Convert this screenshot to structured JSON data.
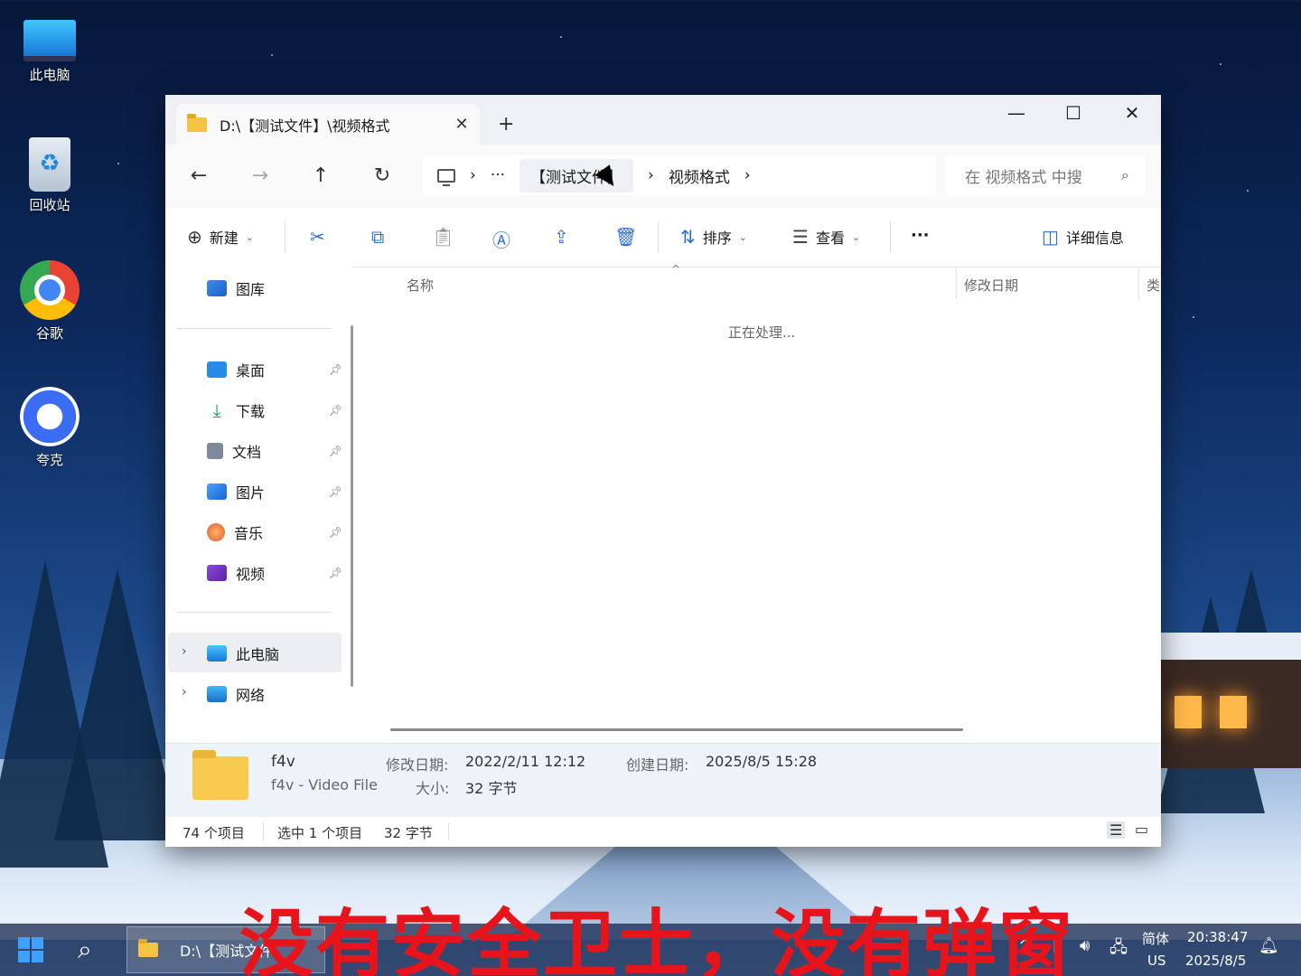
{
  "desktop": {
    "icons": [
      {
        "label": "此电脑"
      },
      {
        "label": "回收站"
      },
      {
        "label": "谷歌"
      },
      {
        "label": "夸克"
      }
    ]
  },
  "explorer": {
    "tab_title": "D:\\【测试文件】\\视频格式",
    "tab_close": "✕",
    "new_tab": "+",
    "window_controls": {
      "minimize": "—",
      "maximize": "☐",
      "close": "✕"
    },
    "nav": {
      "back": "←",
      "forward": "→",
      "up": "↑",
      "refresh": "↻"
    },
    "breadcrumbs": {
      "more": "···",
      "sep": "›",
      "items": [
        "【测试文件】",
        "视频格式"
      ]
    },
    "search": {
      "placeholder": "在 视频格式 中搜",
      "icon": "⌕"
    },
    "toolbar": {
      "new_label": "新建",
      "sort_label": "排序",
      "view_label": "查看",
      "more_label": "···",
      "details_label": "详细信息"
    },
    "sidebar": {
      "top": [
        {
          "label": "图库"
        }
      ],
      "pinned": [
        {
          "label": "桌面"
        },
        {
          "label": "下载"
        },
        {
          "label": "文档"
        },
        {
          "label": "图片"
        },
        {
          "label": "音乐"
        },
        {
          "label": "视频"
        }
      ],
      "locations": [
        {
          "label": "此电脑"
        },
        {
          "label": "网络"
        }
      ]
    },
    "columns": {
      "name": "名称",
      "modified": "修改日期",
      "type": "类"
    },
    "processing_text": "正在处理...",
    "details_pane": {
      "file_name": "f4v",
      "file_type": "f4v - Video File",
      "modified_label": "修改日期:",
      "modified_value": "2022/2/11 12:12",
      "size_label": "大小:",
      "size_value": "32 字节",
      "created_label": "创建日期:",
      "created_value": "2025/8/5 15:28"
    },
    "status_bar": {
      "item_count": "74 个项目",
      "selection": "选中 1 个项目",
      "selection_size": "32 字节"
    }
  },
  "taskbar": {
    "app_label": "D:\\【测试文件",
    "ime_lang": "简体",
    "ime_layout": "US",
    "time": "20:38:47",
    "date": "2025/8/5"
  },
  "caption": "没有安全卫士，没有弹窗",
  "colors": {
    "caption": "#e8141c",
    "accent": "#2e6ed8"
  }
}
